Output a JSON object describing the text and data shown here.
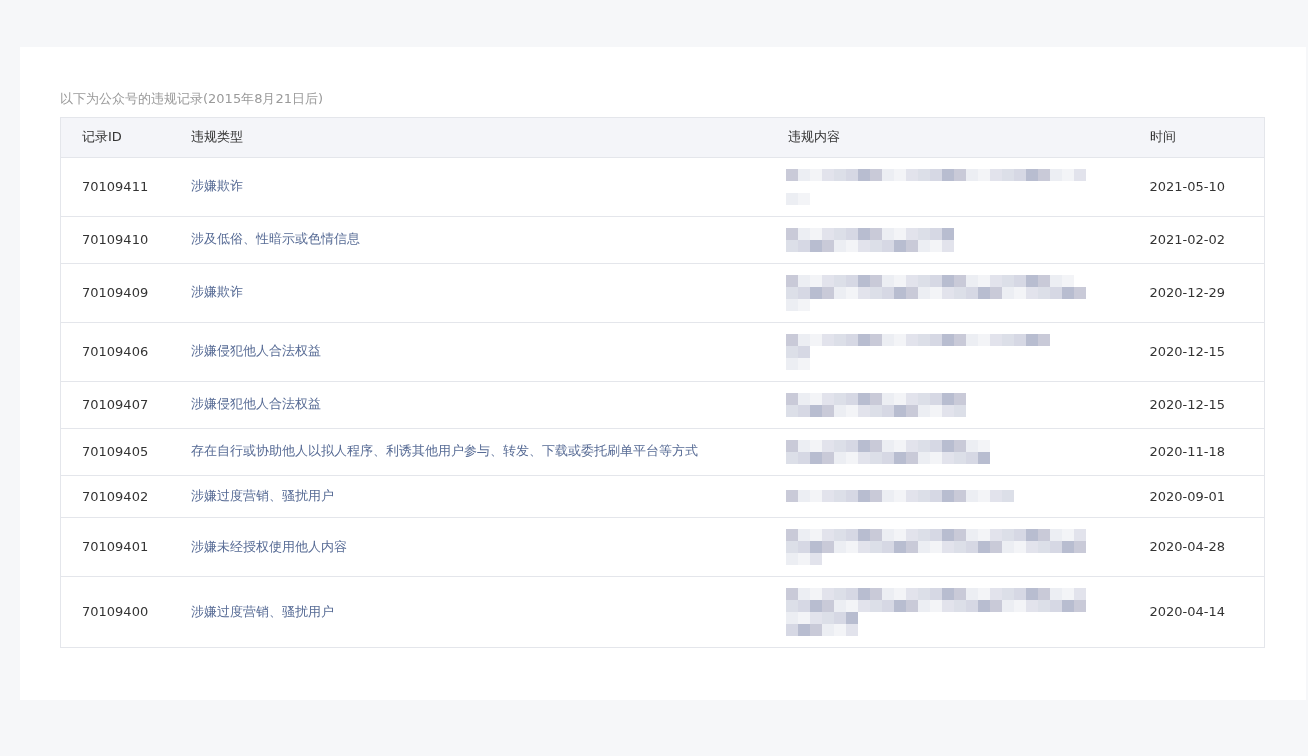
{
  "caption": "以下为公众号的违规记录(2015年8月21日后)",
  "table": {
    "columns": [
      "记录ID",
      "违规类型",
      "违规内容",
      "时间"
    ],
    "rows": [
      {
        "id": "70109411",
        "type": "涉嫌欺诈",
        "time": "2021-05-10"
      },
      {
        "id": "70109410",
        "type": "涉及低俗、性暗示或色情信息",
        "time": "2021-02-02"
      },
      {
        "id": "70109409",
        "type": "涉嫌欺诈",
        "time": "2020-12-29"
      },
      {
        "id": "70109406",
        "type": "涉嫌侵犯他人合法权益",
        "time": "2020-12-15"
      },
      {
        "id": "70109407",
        "type": "涉嫌侵犯他人合法权益",
        "time": "2020-12-15"
      },
      {
        "id": "70109405",
        "type": "存在自行或协助他人以拟人程序、利诱其他用户参与、转发、下载或委托刷单平台等方式",
        "time": "2020-11-18"
      },
      {
        "id": "70109402",
        "type": "涉嫌过度营销、骚扰用户",
        "time": "2020-09-01"
      },
      {
        "id": "70109401",
        "type": "涉嫌未经授权使用他人内容",
        "time": "2020-04-28"
      },
      {
        "id": "70109400",
        "type": "涉嫌过度营销、骚扰用户",
        "time": "2020-04-14"
      }
    ]
  }
}
